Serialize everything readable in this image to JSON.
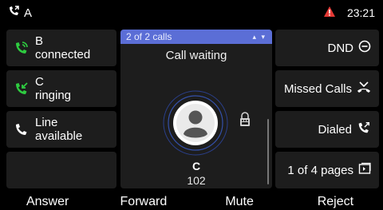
{
  "status": {
    "account": "A",
    "time": "23:21",
    "warning_icon": "warning-icon"
  },
  "lines": [
    {
      "name": "B",
      "state": "connected",
      "icon": "phone-connected-icon",
      "color": "#2ecc40"
    },
    {
      "name": "C",
      "state": "ringing",
      "icon": "phone-incoming-icon",
      "color": "#2ecc40"
    },
    {
      "name": "Line",
      "state": "available",
      "icon": "phone-icon",
      "color": "#ffffff"
    },
    {
      "name": "",
      "state": "",
      "icon": "",
      "color": ""
    }
  ],
  "call_panel": {
    "counter": "2 of 2 calls",
    "title": "Call waiting",
    "contact_name": "C",
    "contact_number": "102"
  },
  "functions": [
    {
      "label": "DND",
      "icon": "dnd-icon"
    },
    {
      "label": "Missed Calls",
      "icon": "missed-calls-icon"
    },
    {
      "label": "Dialed",
      "icon": "dialed-calls-icon"
    },
    {
      "label": "1 of 4 pages",
      "icon": "pages-icon"
    }
  ],
  "softkeys": [
    "Answer",
    "Forward",
    "Mute",
    "Reject"
  ],
  "colors": {
    "accent": "#5b6ed6",
    "green": "#2ecc40",
    "warning": "#e53935",
    "ring": "#2f4fa8"
  }
}
